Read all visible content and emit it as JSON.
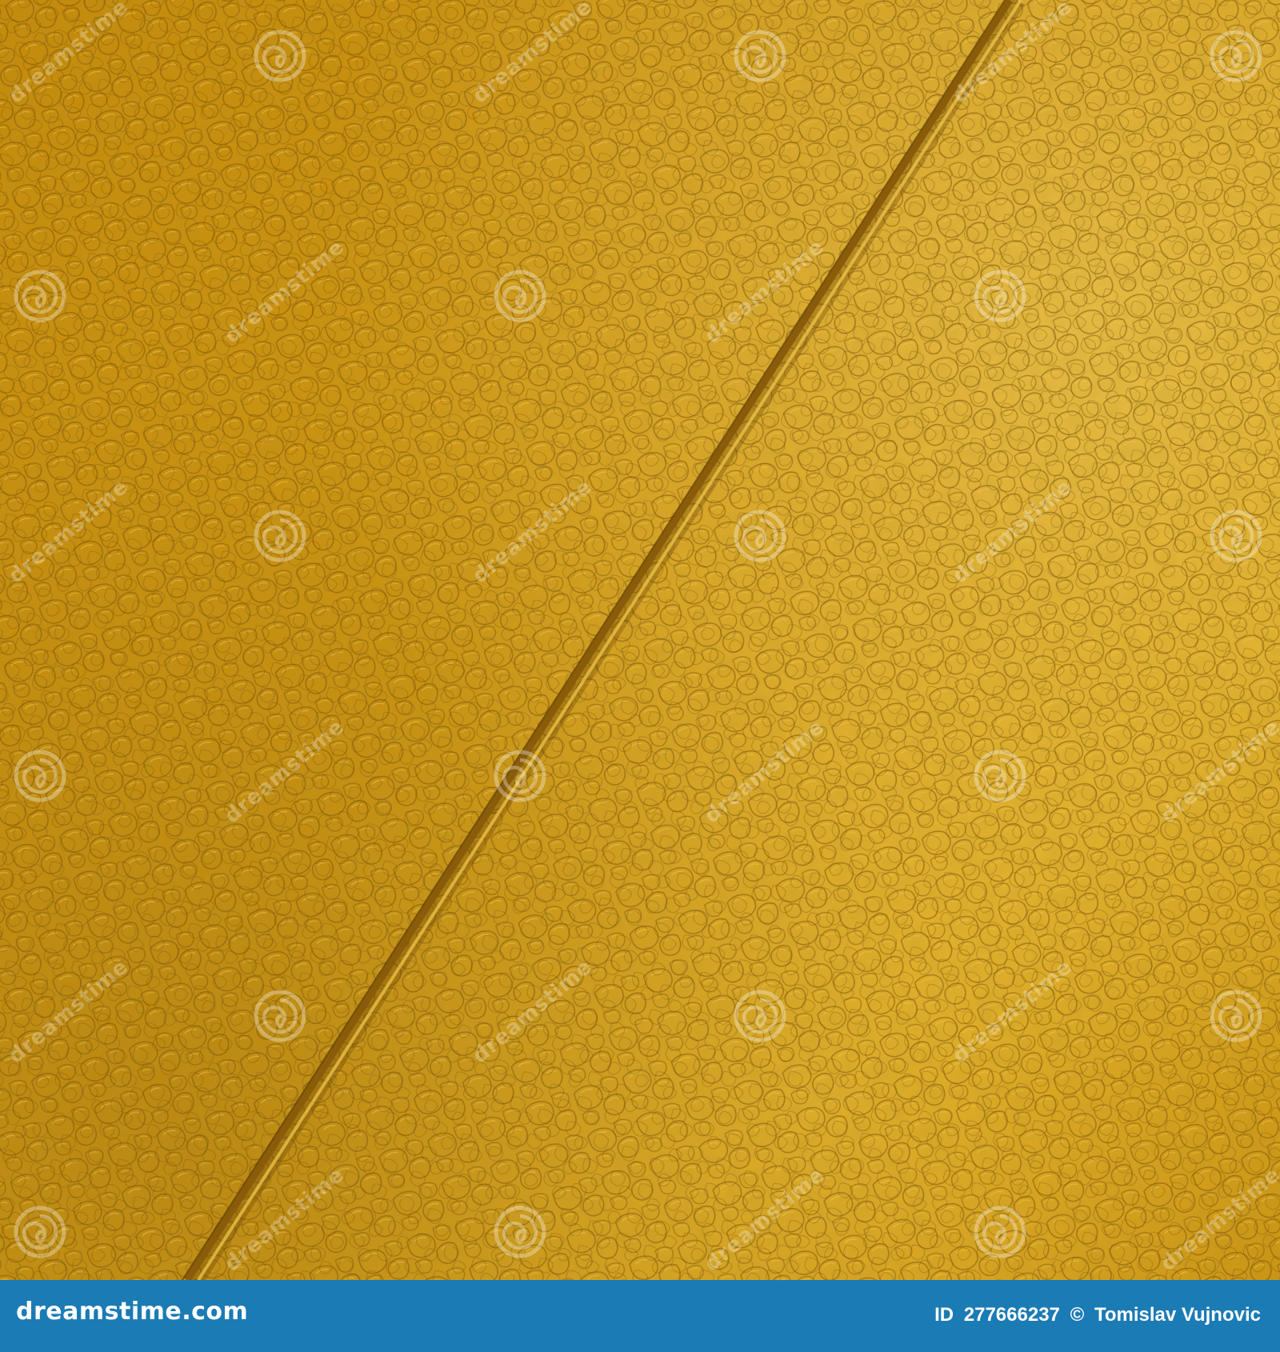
{
  "image": {
    "subject": "yellow-leather-texture",
    "base_color": "#c8930f",
    "highlight_color": "#f2c64a",
    "shadow_color": "#7a5208",
    "seam_color": "#8a5c0a"
  },
  "watermark": {
    "wordmark": "dreamstime",
    "icon": "spiral-logo-icon"
  },
  "credit_bar": {
    "background": "#1b7bb5",
    "brand": "dreamstime.com",
    "id_label": "ID",
    "id_value": "277666237",
    "copyright_symbol": "©",
    "author": "Tomislav Vujnovic"
  }
}
